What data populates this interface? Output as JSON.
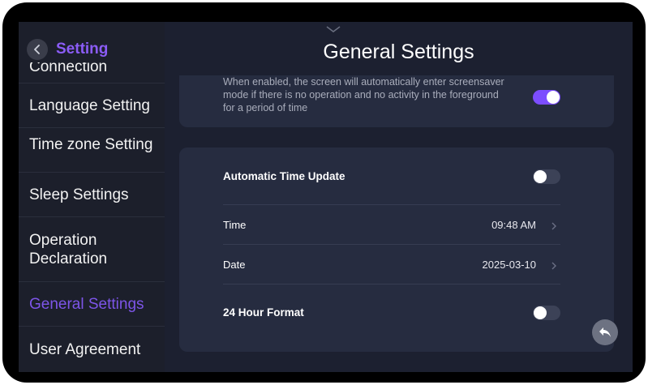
{
  "sidebar": {
    "back_label": "Setting",
    "items": [
      {
        "label": "Connection"
      },
      {
        "label": "Language Setting"
      },
      {
        "label": "Time zone Setting"
      },
      {
        "label": "Sleep Settings"
      },
      {
        "label": "Operation Declaration"
      },
      {
        "label": "General Settings"
      },
      {
        "label": "User Agreement"
      }
    ],
    "active_index": 5
  },
  "header": {
    "title": "General Settings"
  },
  "screensaver": {
    "description": "When enabled, the screen will automatically enter screensaver mode if there is no operation and no activity in the foreground for a period of time",
    "enabled": true
  },
  "time_settings": {
    "auto_update": {
      "label": "Automatic Time Update",
      "enabled": false
    },
    "time": {
      "label": "Time",
      "value": "09:48 AM"
    },
    "date": {
      "label": "Date",
      "value": "2025-03-10"
    },
    "hour_format": {
      "label": "24 Hour Format",
      "enabled": false
    }
  },
  "colors": {
    "accent": "#7c4dff",
    "active_nav": "#7d55e8",
    "background": "#1c2030",
    "card": "#262c40"
  }
}
